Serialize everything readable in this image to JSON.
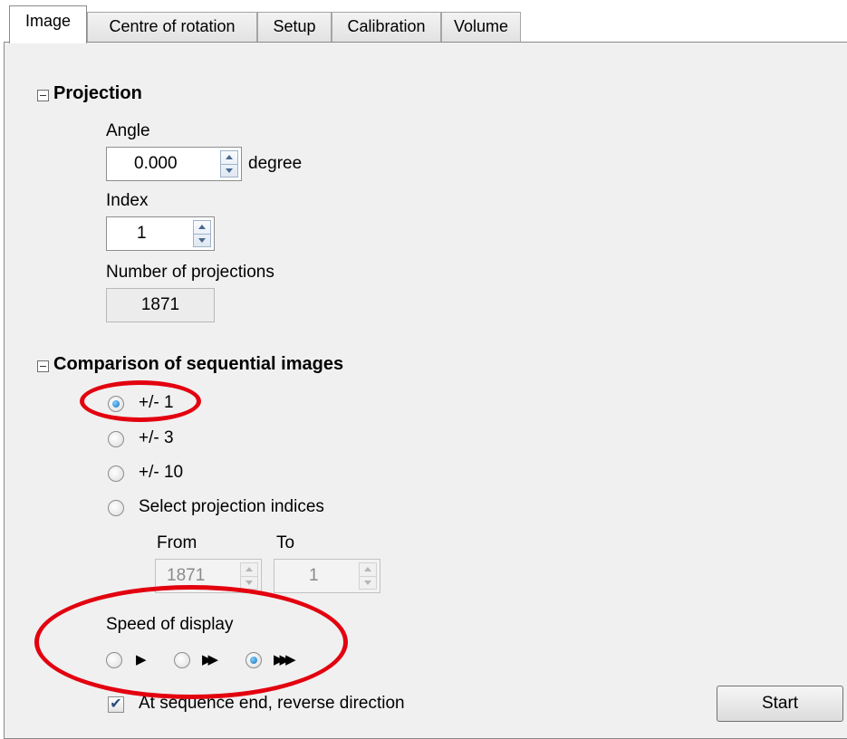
{
  "tabs": [
    {
      "label": "Image",
      "active": true
    },
    {
      "label": "Centre of rotation",
      "active": false
    },
    {
      "label": "Setup",
      "active": false
    },
    {
      "label": "Calibration",
      "active": false
    },
    {
      "label": "Volume",
      "active": false
    }
  ],
  "projection": {
    "title": "Projection",
    "angle_label": "Angle",
    "angle_value": "0.000",
    "angle_unit": "degree",
    "index_label": "Index",
    "index_value": "1",
    "num_label": "Number of projections",
    "num_value": "1871"
  },
  "comparison": {
    "title": "Comparison of sequential images",
    "options": [
      {
        "label": "+/- 1",
        "checked": true
      },
      {
        "label": "+/- 3",
        "checked": false
      },
      {
        "label": "+/- 10",
        "checked": false
      },
      {
        "label": "Select projection indices",
        "checked": false
      }
    ],
    "from_label": "From",
    "from_value": "1871",
    "to_label": "To",
    "to_value": "1",
    "speed_label": "Speed of display",
    "speed_options": [
      {
        "icon": "play-slow-icon",
        "glyph": "▶",
        "checked": false
      },
      {
        "icon": "play-medium-icon",
        "glyph": "▶▶",
        "checked": false
      },
      {
        "icon": "play-fast-icon",
        "glyph": "▶▶▶",
        "checked": true
      }
    ],
    "reverse_label": "At sequence end, reverse direction",
    "reverse_checked": true
  },
  "start_button": "Start",
  "colors": {
    "annotation": "#e3000f",
    "radio_selected": "#1a6fb8"
  }
}
